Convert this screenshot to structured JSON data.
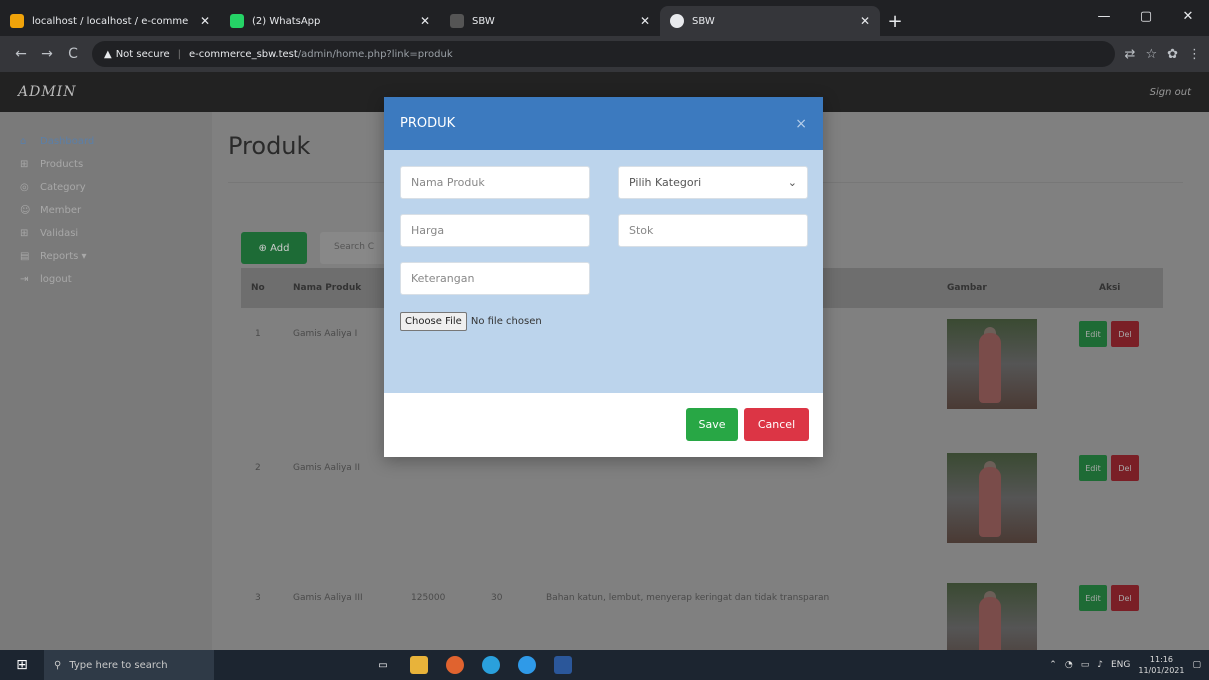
{
  "browser": {
    "tabs": [
      {
        "title": "localhost / localhost / e-comme",
        "favicon_color": "#f0a30a"
      },
      {
        "title": "(2) WhatsApp",
        "favicon_color": "#25d366"
      },
      {
        "title": "SBW",
        "favicon_color": "#555555"
      },
      {
        "title": "SBW",
        "favicon_color": "#e8eaed"
      }
    ],
    "new_tab": "+",
    "minimize": "—",
    "maximize": "▢",
    "close": "✕",
    "address": {
      "security": "Not secure",
      "host": "e-commerce_sbw.test",
      "path": "/admin/home.php?link=produk"
    }
  },
  "app": {
    "brand": "ADMIN",
    "signout": "Sign out",
    "sidebar": [
      {
        "label": "Dashboard",
        "icon": "home-icon"
      },
      {
        "label": "Products",
        "icon": "cart-icon"
      },
      {
        "label": "Category",
        "icon": "tag-icon"
      },
      {
        "label": "Member",
        "icon": "users-icon"
      },
      {
        "label": "Validasi",
        "icon": "cart-icon"
      },
      {
        "label": "Reports ▾",
        "icon": "document-icon"
      },
      {
        "label": "logout",
        "icon": "logout-icon"
      }
    ],
    "page_title": "Produk",
    "add_label": "⊕ Add",
    "search_placeholder": "Search C",
    "table": {
      "headers": {
        "no": "No",
        "nama": "Nama Produk",
        "gambar": "Gambar",
        "aksi": "Aksi"
      },
      "rows": [
        {
          "no": "1",
          "nama": "Gamis Aaliya I",
          "harga": "",
          "stok": "",
          "keterangan": ""
        },
        {
          "no": "2",
          "nama": "Gamis Aaliya II",
          "harga": "",
          "stok": "",
          "keterangan": ""
        },
        {
          "no": "3",
          "nama": "Gamis Aaliya III",
          "harga": "125000",
          "stok": "30",
          "keterangan": "Bahan katun, lembut, menyerap keringat dan tidak transparan"
        }
      ],
      "edit_label": "Edit",
      "del_label": "Del"
    }
  },
  "modal": {
    "title": "PRODUK",
    "close": "×",
    "nama_placeholder": "Nama Produk",
    "kategori_selected": "Pilih Kategori",
    "harga_placeholder": "Harga",
    "stok_placeholder": "Stok",
    "keterangan_placeholder": "Keterangan",
    "file_button": "Choose File",
    "file_status": "No file chosen",
    "save": "Save",
    "cancel": "Cancel"
  },
  "taskbar": {
    "search_placeholder": "Type here to search",
    "lang": "ENG",
    "time": "11:16",
    "date": "11/01/2021"
  }
}
